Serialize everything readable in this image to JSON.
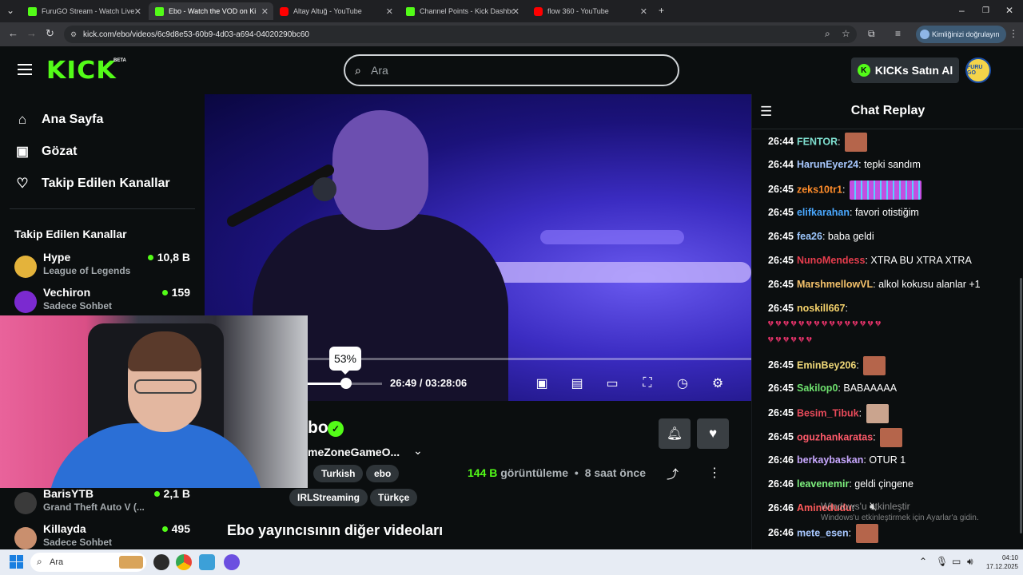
{
  "browser": {
    "tabs": [
      {
        "label": "FuruGO Stream - Watch Live on",
        "favicon": "kick",
        "active": false
      },
      {
        "label": "Ebo - Watch the VOD on Ki",
        "favicon": "kick",
        "active": true
      },
      {
        "label": "Altay Altuğ - YouTube",
        "favicon": "youtube",
        "active": false
      },
      {
        "label": "Channel Points - Kick Dashboar",
        "favicon": "kick",
        "active": false
      },
      {
        "label": "flow 360 - YouTube",
        "favicon": "youtube",
        "active": false
      }
    ],
    "url": "kick.com/ebo/videos/6c9d8e53-60b9-4d03-a694-04020290bc60",
    "verify_label": "Kimliğinizi doğrulayın"
  },
  "header": {
    "logo": "KICK",
    "beta": "BETA",
    "search_placeholder": "Ara",
    "buy_kicks": "KICKs Satın Al",
    "avatar_text": "FURU GO"
  },
  "sidebar": {
    "nav": [
      {
        "label": "Ana Sayfa",
        "icon": "home-icon"
      },
      {
        "label": "Gözat",
        "icon": "browse-icon"
      },
      {
        "label": "Takip Edilen Kanallar",
        "icon": "heart-icon"
      }
    ],
    "followed_title": "Takip Edilen Kanallar",
    "channels": [
      {
        "name": "Hype",
        "game": "League of Legends",
        "viewers": "10,8 B",
        "color": "#e4b33b"
      },
      {
        "name": "Vechiron",
        "game": "Sadece Sohbet",
        "viewers": "159",
        "color": "#7b2ad0"
      },
      {
        "name": "BarisYTB",
        "game": "Grand Theft Auto V (...",
        "viewers": "2,1 B",
        "color": "#3a3a3a"
      },
      {
        "name": "Killayda",
        "game": "Sadece Sohbet",
        "viewers": "495",
        "color": "#c98f6e"
      }
    ]
  },
  "player": {
    "tooltip": "53%",
    "progress": 0.13,
    "volume": 0.53,
    "current_time": "26:49",
    "separator": "/",
    "duration": "03:28:06"
  },
  "video_info": {
    "title_fragment": "bo",
    "category_fragment": "meZoneGameO...",
    "tags_row1": [
      "Turkish",
      "ebo"
    ],
    "tags_row2": [
      "IRLStreaming",
      "Türkçe"
    ],
    "views_number": "144 B",
    "views_label": "görüntüleme",
    "time_ago": "8 saat önce",
    "other_videos": "Ebo yayıncısının diğer videoları"
  },
  "chat": {
    "title": "Chat Replay",
    "messages": [
      {
        "ts": "26:44",
        "user": "FENTOR",
        "color": "#7fe0d0",
        "text": "",
        "emote": "face"
      },
      {
        "ts": "26:44",
        "user": "HarunEyer24",
        "color": "#a8c8ff",
        "text": "tepki sandım",
        "emote": ""
      },
      {
        "ts": "26:45",
        "user": "zeks10tr1",
        "color": "#ff8c2a",
        "text": "",
        "emote": "equalizer"
      },
      {
        "ts": "26:45",
        "user": "elifkarahan",
        "color": "#4aa8ff",
        "text": "favori otistiğim",
        "emote": ""
      },
      {
        "ts": "26:45",
        "user": "fea26",
        "color": "#9ec8ff",
        "text": "baba geldi",
        "emote": ""
      },
      {
        "ts": "26:45",
        "user": "NunoMendess",
        "color": "#e63d4d",
        "text": "XTRA BU XTRA XTRA",
        "emote": ""
      },
      {
        "ts": "26:45",
        "user": "MarshmellowVL",
        "color": "#f5c26b",
        "text": "alkol kokusu alanlar +1",
        "emote": ""
      },
      {
        "ts": "26:45",
        "user": "noskill667",
        "color": "#f5d26b",
        "text": "",
        "emote": "hearts"
      },
      {
        "ts": "26:45",
        "user": "EminBey206",
        "color": "#f0d878",
        "text": "",
        "emote": "face"
      },
      {
        "ts": "26:45",
        "user": "Sakilop0",
        "color": "#6ee06e",
        "text": "BABAAAAA",
        "emote": ""
      },
      {
        "ts": "26:45",
        "user": "Besim_Tibuk",
        "color": "#e84a5a",
        "text": "",
        "emote": "face2"
      },
      {
        "ts": "26:45",
        "user": "oguzhankaratas",
        "color": "#ff5a6a",
        "text": "",
        "emote": "face"
      },
      {
        "ts": "26:46",
        "user": "berkaybaskan",
        "color": "#c8a8ff",
        "text": "OTUR 1",
        "emote": ""
      },
      {
        "ts": "26:46",
        "user": "leavenemir",
        "color": "#7ef07e",
        "text": "geldi çingene",
        "emote": ""
      },
      {
        "ts": "26:46",
        "user": "Aminedudu",
        "color": "#ff5a5a",
        "text": "",
        "emote": ""
      },
      {
        "ts": "26:46",
        "user": "mete_esen",
        "color": "#a8c8ff",
        "text": "",
        "emote": "face"
      }
    ]
  },
  "watermark": {
    "line1": "Windows'u etkinleştir",
    "line2": "Windows'u etkinleştirmek için Ayarlar'a gidin."
  },
  "taskbar": {
    "search_placeholder": "Ara",
    "time": "04:10",
    "date": "17.12.2025"
  },
  "colors": {
    "accent": "#53fc18",
    "background": "#0b0e0f"
  }
}
